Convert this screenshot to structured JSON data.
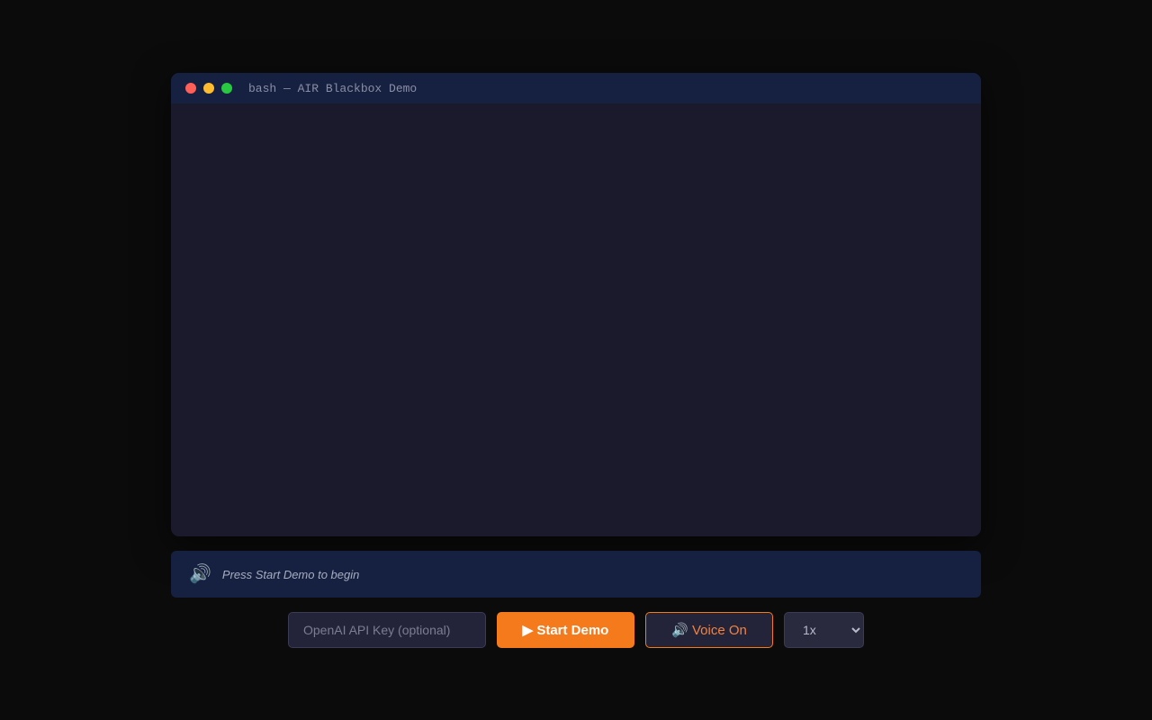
{
  "terminal": {
    "title": "bash — AIR Blackbox Demo",
    "colors": {
      "red": "#ff5f57",
      "yellow": "#febc2e",
      "green": "#28c840"
    }
  },
  "narration": {
    "icon": "speaker-icon",
    "text": "Press Start Demo to begin"
  },
  "controls": {
    "api_key_placeholder": "OpenAI API Key (optional)",
    "api_key_value": "",
    "start_label": "▶ Start Demo",
    "voice_label": "🔊 Voice On",
    "speed_selected": "1x",
    "speed_options": [
      "1x"
    ]
  },
  "colors": {
    "accent": "#f57a1c",
    "background": "#0b0b0b",
    "panel": "#162040",
    "terminal_bg": "#1b1a2c"
  }
}
